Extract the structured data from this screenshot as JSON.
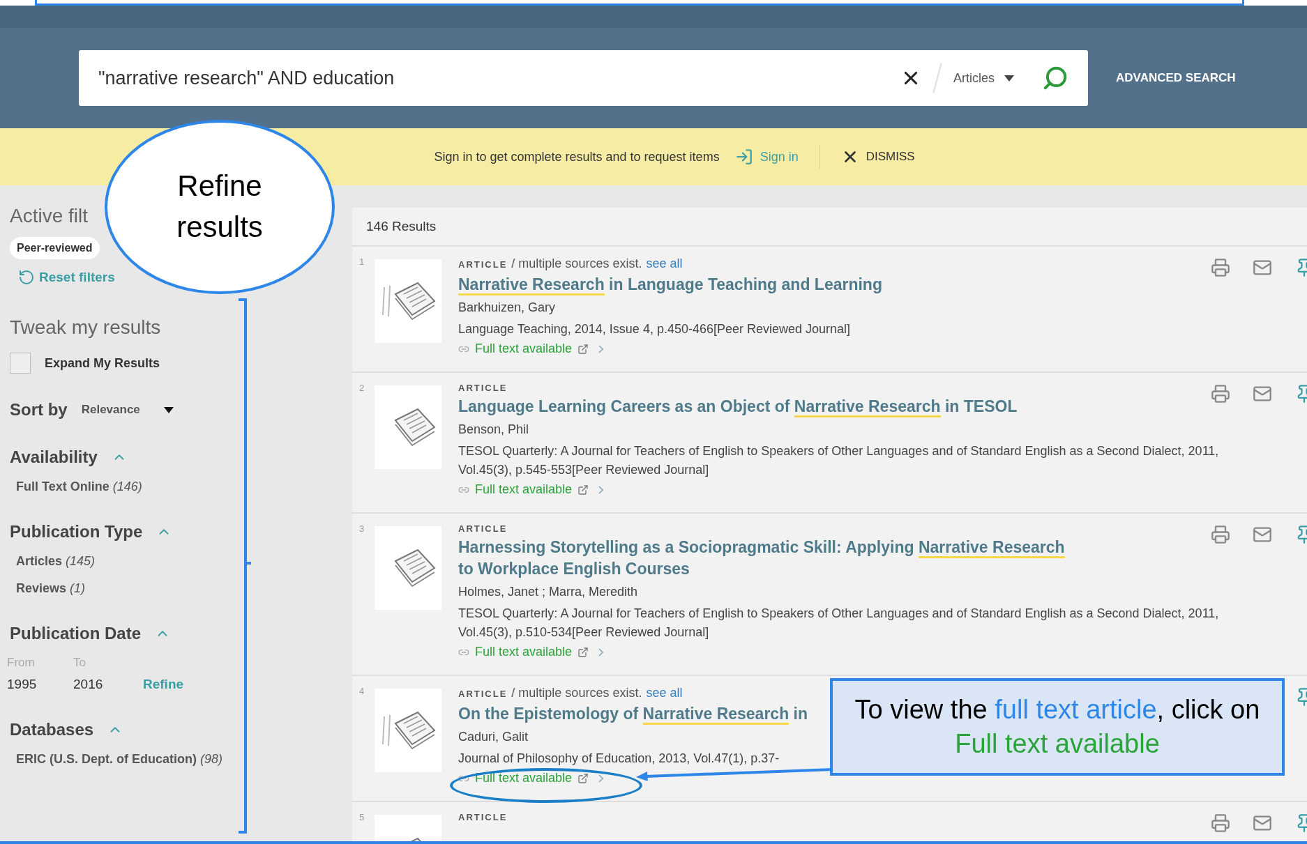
{
  "search": {
    "value": "\"narrative research\" AND education",
    "scope": "Articles",
    "advanced": "ADVANCED SEARCH"
  },
  "banner": {
    "message": "Sign in to get complete results and to request items",
    "sign_in": "Sign in",
    "dismiss": "DISMISS"
  },
  "sidebar": {
    "active_filters_heading": "Active filt",
    "chips": [
      "Peer-reviewed"
    ],
    "reset": "Reset filters",
    "tweak_heading": "Tweak my results",
    "expand": {
      "label": "Expand My Results",
      "checked": false
    },
    "sort": {
      "label": "Sort by",
      "value": "Relevance"
    },
    "facets": [
      {
        "kind": "list",
        "title": "Availability",
        "expanded": true,
        "items": [
          {
            "label": "Full Text Online",
            "count": "(146)"
          }
        ]
      },
      {
        "kind": "list",
        "title": "Publication Type",
        "expanded": true,
        "items": [
          {
            "label": "Articles",
            "count": "(145)"
          },
          {
            "label": "Reviews",
            "count": "(1)"
          }
        ]
      },
      {
        "kind": "date",
        "title": "Publication Date",
        "expanded": true,
        "from_label": "From",
        "to_label": "To",
        "from": "1995",
        "to": "2016",
        "refine": "Refine"
      },
      {
        "kind": "list",
        "title": "Databases",
        "expanded": true,
        "items": [
          {
            "label": "ERIC (U.S. Dept. of Education)",
            "count": "(98)"
          }
        ]
      }
    ]
  },
  "results": {
    "count": "146 Results",
    "rows": [
      {
        "number": "1",
        "type": "ARTICLE",
        "sources_note": "/ multiple sources exist.",
        "see_all": "see all",
        "title_parts": [
          {
            "text": "Narrative Research",
            "highlight": true
          },
          {
            "text": " in Language Teaching and Learning",
            "highlight": false
          }
        ],
        "authors": "Barkhuizen, Gary",
        "source": "Language Teaching, 2014, Issue 4, p.450-466[Peer Reviewed Journal]",
        "link": "Full text available"
      },
      {
        "number": "2",
        "type": "ARTICLE",
        "title_parts": [
          {
            "text": "Language Learning Careers as an Object of ",
            "highlight": false
          },
          {
            "text": "Narrative Research",
            "highlight": true
          },
          {
            "text": " in TESOL",
            "highlight": false
          }
        ],
        "authors": "Benson, Phil",
        "source": "TESOL Quarterly: A Journal for Teachers of English to Speakers of Other Languages and of Standard English as a Second Dialect, 2011, Vol.45(3), p.545-553[Peer Reviewed Journal]",
        "link": "Full text available"
      },
      {
        "number": "3",
        "type": "ARTICLE",
        "title_parts": [
          {
            "text": "Harnessing Storytelling as a Sociopragmatic Skill: Applying ",
            "highlight": false
          },
          {
            "text": "Narrative Research",
            "highlight": true
          },
          {
            "text": " to Workplace English Courses",
            "highlight": false
          }
        ],
        "authors": "Holmes, Janet ; Marra, Meredith",
        "source": "TESOL Quarterly: A Journal for Teachers of English to Speakers of Other Languages and of Standard English as a Second Dialect, 2011, Vol.45(3), p.510-534[Peer Reviewed Journal]",
        "link": "Full text available"
      },
      {
        "number": "4",
        "type": "ARTICLE",
        "sources_note": "/ multiple sources exist.",
        "see_all": "see all",
        "title_parts": [
          {
            "text": "On the Epistemology of ",
            "highlight": false
          },
          {
            "text": "Narrative Research",
            "highlight": true
          },
          {
            "text": " in",
            "highlight": false
          }
        ],
        "authors": "Caduri, Galit",
        "source": "Journal of Philosophy of Education, 2013, Vol.47(1), p.37-",
        "link": "Full text available"
      },
      {
        "number": "5",
        "type": "ARTICLE"
      }
    ]
  },
  "annotations": [
    {
      "kind": "ellipse",
      "text": "Refine results"
    },
    {
      "kind": "box",
      "parts": [
        {
          "text": "To view the ",
          "color": "#000000"
        },
        {
          "text": "full text article",
          "color": "#2e86e8"
        },
        {
          "text": ", click on ",
          "color": "#000000"
        },
        {
          "text": "Full text available",
          "color": "#2aa33a"
        }
      ]
    }
  ]
}
